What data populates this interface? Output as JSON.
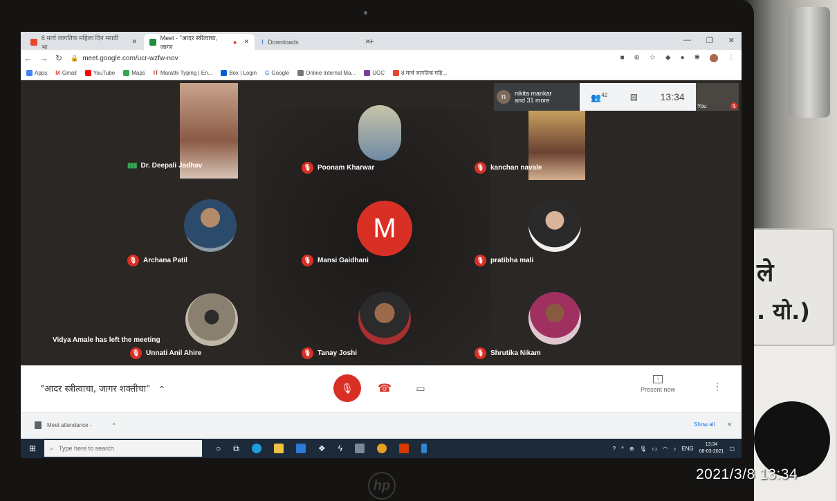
{
  "browser": {
    "tabs": [
      {
        "label": "8 मार्च जागतिक महिला दिन मराठी भा",
        "color": "#e8472c"
      },
      {
        "label": "Meet - \"आदर स्त्रीत्वाचा, जागर",
        "color": "#1e8e3e"
      },
      {
        "label": "Downloads",
        "color": "#1a73e8"
      }
    ],
    "url": "meet.google.com/ucr-wzfw-nov",
    "bookmarks": [
      {
        "label": "Apps",
        "color": "#4285f4"
      },
      {
        "label": "Gmail",
        "color": "#ea4335"
      },
      {
        "label": "YouTube",
        "color": "#ff0000"
      },
      {
        "label": "Maps",
        "color": "#34a853"
      },
      {
        "label": "Marathi Typing | En...",
        "color": "#c0392b"
      },
      {
        "label": "Box | Login",
        "color": "#0061d5"
      },
      {
        "label": "Google",
        "color": "#4285f4"
      },
      {
        "label": "Online Internal Ma...",
        "color": "#777777"
      },
      {
        "label": "UGC",
        "color": "#7b3fa0"
      },
      {
        "label": "8 मार्च जागतिक महि...",
        "color": "#e8472c"
      }
    ]
  },
  "meet": {
    "participants_preview": {
      "name": "nikita mankar",
      "more": "and 31 more",
      "initial": "n"
    },
    "people_count": "42",
    "time": "13:34",
    "self_label": "You",
    "toast": "Vidya Amale has left the meeting",
    "tiles": [
      {
        "name": "Dr. Deepali Jadhav",
        "speaking": true
      },
      {
        "name": "Poonam Kharwar"
      },
      {
        "name": "kanchan navale"
      },
      {
        "name": "Archana Patil"
      },
      {
        "name": "Mansi Gaidhani",
        "initial": "M"
      },
      {
        "name": "pratibha mali"
      },
      {
        "name": "Unnati Anil Ahire"
      },
      {
        "name": "Tanay Joshi"
      },
      {
        "name": "Shrutika Nikam"
      }
    ],
    "meeting_title": "\"आदर स्त्रीत्वाचा, जागर शक्तीचा\"",
    "present_label": "Present now"
  },
  "downloads": {
    "file": "Meet attendance -",
    "show_all": "Show all"
  },
  "taskbar": {
    "search_placeholder": "Type here to search",
    "lang": "ENG",
    "time": "13:34",
    "date": "08-03-2021"
  },
  "physical": {
    "stamp": "2021/3/8  13:34",
    "sign_line1": "ले",
    "sign_line2": ". यो.)",
    "laptop_logo": "hp"
  }
}
